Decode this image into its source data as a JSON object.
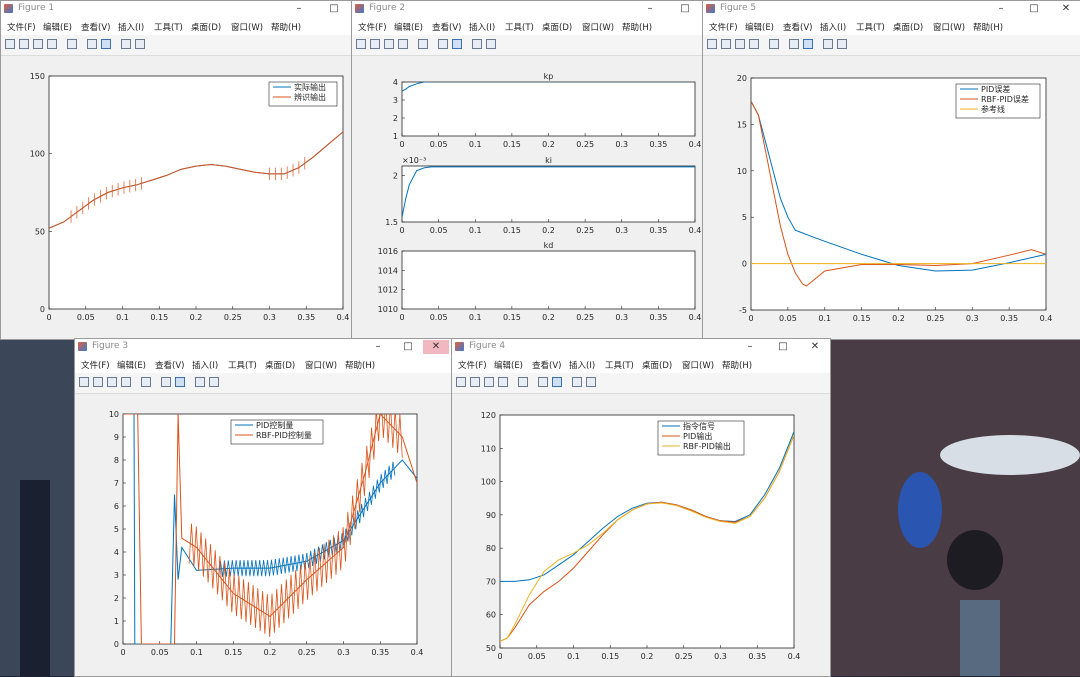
{
  "menu": [
    "文件(F)",
    "编辑(E)",
    "查看(V)",
    "插入(I)",
    "工具(T)",
    "桌面(D)",
    "窗口(W)",
    "帮助(H)"
  ],
  "window_controls": {
    "min": "–",
    "max": "□",
    "close": "✕"
  },
  "colors": {
    "blue": "#0072BD",
    "orange": "#D95319",
    "yellow": "#EDB120",
    "axis": "#262626"
  },
  "toolbar_icons": [
    "new-file-icon",
    "open-folder-icon",
    "save-icon",
    "print-icon",
    "print-preview-icon",
    "link-plot-icon",
    "insert-legend-icon",
    "pointer-icon",
    "property-inspector-icon"
  ],
  "figures": {
    "fig1": {
      "title": "Figure 1",
      "chart_data": {
        "type": "line",
        "xlim": [
          0,
          0.4
        ],
        "ylim": [
          0,
          150
        ],
        "xticks": [
          "0",
          "0.05",
          "0.1",
          "0.15",
          "0.2",
          "0.25",
          "0.3",
          "0.35",
          "0.4"
        ],
        "yticks": [
          "0",
          "50",
          "100",
          "150"
        ],
        "legend_position": "top-right",
        "series": [
          {
            "name": "实际输出",
            "color": "#0072BD",
            "x": [
              0,
              0.02,
              0.04,
              0.06,
              0.08,
              0.1,
              0.12,
              0.14,
              0.16,
              0.18,
              0.2,
              0.22,
              0.24,
              0.26,
              0.28,
              0.3,
              0.32,
              0.34,
              0.36,
              0.38,
              0.4
            ],
            "y": [
              52,
              56,
              63,
              70,
              75,
              78,
              80,
              83,
              86,
              90,
              92,
              93,
              92,
              90,
              88,
              87,
              87,
              91,
              98,
              106,
              114
            ]
          },
          {
            "name": "辨识输出",
            "color": "#D95319",
            "x": [
              0,
              0.02,
              0.04,
              0.06,
              0.08,
              0.1,
              0.12,
              0.14,
              0.16,
              0.18,
              0.2,
              0.22,
              0.24,
              0.26,
              0.28,
              0.3,
              0.32,
              0.34,
              0.36,
              0.38,
              0.4
            ],
            "y": [
              52,
              56,
              63,
              70,
              75,
              78,
              80,
              83,
              86,
              90,
              92,
              93,
              92,
              90,
              88,
              87,
              87,
              91,
              98,
              106,
              114
            ]
          }
        ]
      }
    },
    "fig2": {
      "title": "Figure 2",
      "chart_data": [
        {
          "type": "line",
          "title": "kp",
          "xlim": [
            0,
            0.4
          ],
          "ylim": [
            1,
            4
          ],
          "yticks": [
            "1",
            "2",
            "3",
            "4"
          ],
          "xticks": [
            "0",
            "0.05",
            "0.1",
            "0.15",
            "0.2",
            "0.25",
            "0.3",
            "0.35",
            "0.4"
          ],
          "series": [
            {
              "color": "#0072BD",
              "x": [
                0,
                0.005,
                0.01,
                0.02,
                0.03,
                0.04,
                0.4
              ],
              "y": [
                3.5,
                3.6,
                3.75,
                3.9,
                4.0,
                4.02,
                4.02
              ]
            }
          ]
        },
        {
          "type": "line",
          "title": "ki",
          "exponent": "×10⁻³",
          "xlim": [
            0,
            0.4
          ],
          "ylim": [
            1.5,
            2.1
          ],
          "yticks": [
            "1.5",
            "2"
          ],
          "xticks": [
            "0",
            "0.05",
            "0.1",
            "0.15",
            "0.2",
            "0.25",
            "0.3",
            "0.35",
            "0.4"
          ],
          "series": [
            {
              "color": "#0072BD",
              "x": [
                0,
                0.005,
                0.01,
                0.02,
                0.03,
                0.04,
                0.4
              ],
              "y": [
                1.55,
                1.75,
                1.9,
                2.05,
                2.08,
                2.09,
                2.09
              ]
            }
          ]
        },
        {
          "type": "line",
          "title": "kd",
          "xlim": [
            0,
            0.4
          ],
          "ylim": [
            1010,
            1016
          ],
          "yticks": [
            "1010",
            "1012",
            "1014",
            "1016"
          ],
          "xticks": [
            "0",
            "0.05",
            "0.1",
            "0.15",
            "0.2",
            "0.25",
            "0.3",
            "0.35",
            "0.4"
          ],
          "series": [
            {
              "color": "#0072BD",
              "x": [
                0,
                0.4
              ],
              "y": [
                1016.1,
                1016.1
              ]
            }
          ]
        }
      ]
    },
    "fig5": {
      "title": "Figure 5",
      "chart_data": {
        "type": "line",
        "xlim": [
          0,
          0.4
        ],
        "ylim": [
          -5,
          20
        ],
        "xticks": [
          "0",
          "0.05",
          "0.1",
          "0.15",
          "0.2",
          "0.25",
          "0.3",
          "0.35",
          "0.4"
        ],
        "yticks": [
          "-5",
          "0",
          "5",
          "10",
          "15",
          "20"
        ],
        "legend_position": "top-right",
        "series": [
          {
            "name": "PID误差",
            "color": "#0072BD",
            "x": [
              0,
              0.01,
              0.02,
              0.03,
              0.04,
              0.05,
              0.06,
              0.07,
              0.08,
              0.1,
              0.15,
              0.2,
              0.25,
              0.3,
              0.35,
              0.4
            ],
            "y": [
              17.5,
              16,
              13,
              10,
              7,
              5,
              3.6,
              3.3,
              3.0,
              2.4,
              1,
              -0.2,
              -0.8,
              -0.7,
              0.1,
              1.0
            ]
          },
          {
            "name": "RBF-PID误差",
            "color": "#D95319",
            "x": [
              0,
              0.01,
              0.02,
              0.03,
              0.04,
              0.05,
              0.06,
              0.07,
              0.075,
              0.08,
              0.1,
              0.15,
              0.2,
              0.25,
              0.3,
              0.35,
              0.38,
              0.4
            ],
            "y": [
              17.5,
              16,
              12,
              8,
              4,
              1,
              -1,
              -2.2,
              -2.4,
              -2.1,
              -0.8,
              -0.1,
              -0.1,
              -0.2,
              0,
              0.9,
              1.5,
              1.0
            ]
          },
          {
            "name": "参考线",
            "color": "#EDB120",
            "x": [
              0,
              0.4
            ],
            "y": [
              0,
              0
            ]
          }
        ]
      }
    },
    "fig3": {
      "title": "Figure 3",
      "chart_data": {
        "type": "line",
        "xlim": [
          0,
          0.4
        ],
        "ylim": [
          0,
          10
        ],
        "xticks": [
          "0",
          "0.05",
          "0.1",
          "0.15",
          "0.2",
          "0.25",
          "0.3",
          "0.35",
          "0.4"
        ],
        "yticks": [
          "0",
          "1",
          "2",
          "3",
          "4",
          "5",
          "6",
          "7",
          "8",
          "9",
          "10"
        ],
        "legend_position": "top-right",
        "series": [
          {
            "name": "PID控制量",
            "color": "#0072BD",
            "x": [
              0,
              0.015,
              0.016,
              0.065,
              0.07,
              0.075,
              0.08,
              0.1,
              0.15,
              0.2,
              0.25,
              0.3,
              0.35,
              0.38,
              0.4
            ],
            "y": [
              10,
              10,
              0,
              0,
              6.5,
              2.8,
              4.2,
              3.2,
              3.3,
              3.3,
              3.6,
              4.5,
              7.0,
              8.0,
              7.2
            ]
          },
          {
            "name": "RBF-PID控制量",
            "color": "#D95319",
            "x": [
              0,
              0.02,
              0.025,
              0.07,
              0.075,
              0.08,
              0.1,
              0.15,
              0.2,
              0.25,
              0.3,
              0.33,
              0.35,
              0.38,
              0.4
            ],
            "y": [
              10,
              10,
              0,
              0,
              10,
              4.6,
              4.2,
              2.2,
              1.2,
              2.8,
              4.2,
              7.5,
              10,
              9,
              7.0
            ]
          }
        ]
      }
    },
    "fig4": {
      "title": "Figure 4",
      "chart_data": {
        "type": "line",
        "xlim": [
          0,
          0.4
        ],
        "ylim": [
          50,
          120
        ],
        "xticks": [
          "0",
          "0.05",
          "0.1",
          "0.15",
          "0.2",
          "0.25",
          "0.3",
          "0.35",
          "0.4"
        ],
        "yticks": [
          "50",
          "60",
          "70",
          "80",
          "90",
          "100",
          "110",
          "120"
        ],
        "legend_position": "top-center",
        "series": [
          {
            "name": "指令信号",
            "color": "#0072BD",
            "x": [
              0,
              0.02,
              0.04,
              0.06,
              0.08,
              0.1,
              0.12,
              0.14,
              0.16,
              0.18,
              0.2,
              0.22,
              0.24,
              0.26,
              0.28,
              0.3,
              0.32,
              0.34,
              0.36,
              0.38,
              0.4
            ],
            "y": [
              70,
              70,
              70.5,
              72,
              75,
              78,
              82,
              86,
              89.5,
              92,
              93.5,
              93.8,
              93,
              91.5,
              89.5,
              88.2,
              88,
              90,
              96,
              104,
              115
            ]
          },
          {
            "name": "PID输出",
            "color": "#D95319",
            "x": [
              0,
              0.01,
              0.02,
              0.04,
              0.06,
              0.08,
              0.1,
              0.12,
              0.14,
              0.16,
              0.18,
              0.2,
              0.22,
              0.24,
              0.26,
              0.28,
              0.3,
              0.32,
              0.34,
              0.36,
              0.38,
              0.4
            ],
            "y": [
              52,
              53,
              56,
              63,
              67,
              70,
              74,
              79,
              84,
              88.5,
              91.5,
              93.3,
              93.8,
              93,
              91.5,
              89.5,
              88.2,
              87.8,
              89.5,
              95,
              103,
              114
            ]
          },
          {
            "name": "RBF-PID输出",
            "color": "#EDB120",
            "x": [
              0,
              0.01,
              0.02,
              0.04,
              0.06,
              0.08,
              0.1,
              0.12,
              0.14,
              0.16,
              0.18,
              0.2,
              0.22,
              0.24,
              0.26,
              0.28,
              0.3,
              0.32,
              0.34,
              0.36,
              0.38,
              0.4
            ],
            "y": [
              52,
              53,
              57,
              66,
              73,
              76.5,
              78.5,
              81,
              84.5,
              88.5,
              91.5,
              93.3,
              93.6,
              92.8,
              91.2,
              89.3,
              88,
              87.5,
              89.5,
              95,
              103,
              114
            ]
          }
        ]
      }
    }
  }
}
